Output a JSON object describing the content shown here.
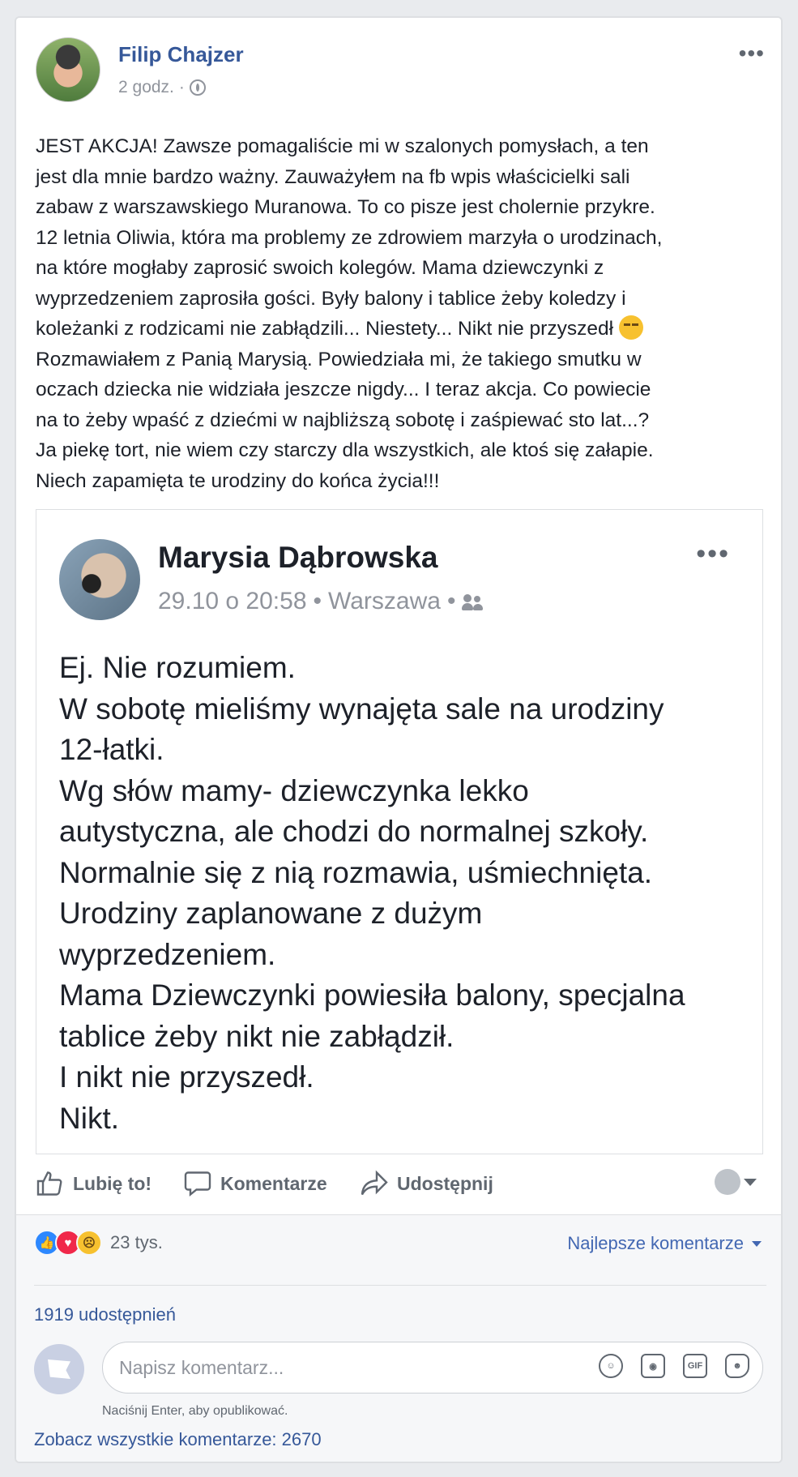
{
  "post": {
    "author": "Filip Chajzer",
    "time": "2 godz.",
    "separator": "·",
    "more": "•••",
    "text_lines": [
      "JEST AKCJA! Zawsze pomagaliście mi w szalonych pomysłach, a ten",
      "jest dla mnie bardzo ważny. Zauważyłem na fb wpis właścicielki sali",
      "zabaw z warszawskiego Muranowa. To co pisze jest cholernie przykre.",
      "12 letnia Oliwia, która ma problemy ze zdrowiem marzyła o urodzinach,",
      "na które mogłaby zaprosić swoich kolegów. Mama dziewczynki z",
      "wyprzedzeniem zaprosiła gości. Były balony i tablice żeby koledzy i",
      "koleżanki z rodzicami nie zabłądzili... Niestety... Nikt nie przyszedł",
      "Rozmawiałem z Panią Marysią. Powiedziała mi, że takiego smutku w",
      "oczach dziecka nie widziała jeszcze nigdy... I teraz akcja. Co powiecie",
      "na to żeby wpaść z dziećmi w najbliższą sobotę i zaśpiewać sto lat...?",
      "Ja piekę tort, nie wiem czy starczy dla wszystkich, ale ktoś się załapie.",
      "Niech zapamięta te urodziny do końca życia!!!"
    ]
  },
  "shared": {
    "author": "Marysia Dąbrowska",
    "date": "29.10 o 20:58",
    "location": "Warszawa",
    "dot": "•",
    "more": "•••",
    "text_lines": [
      "Ej. Nie rozumiem.",
      "W sobotę mieliśmy wynajęta sale na urodziny",
      "12-łatki.",
      "Wg słów mamy- dziewczynka lekko",
      "autystyczna, ale chodzi do normalnej szkoły.",
      "Normalnie się z nią rozmawia, uśmiechnięta.",
      "Urodziny zaplanowane z dużym",
      "wyprzedzeniem.",
      "Mama Dziewczynki powiesiła balony, specjalna",
      "tablice żeby nikt nie zabłądził.",
      "I nikt nie przyszedł.",
      "Nikt."
    ]
  },
  "actions": {
    "like": "Lubię to!",
    "comment": "Komentarze",
    "share": "Udostępnij"
  },
  "footer": {
    "reaction_count": "23 tys.",
    "top_comments": "Najlepsze komentarze",
    "shares": "1919 udostępnień",
    "comment_placeholder": "Napisz komentarz...",
    "gif_label": "GIF",
    "hint": "Naciśnij Enter, aby opublikować.",
    "see_all": "Zobacz wszystkie komentarze: 2670"
  },
  "colors": {
    "link": "#365899",
    "accent": "#4267b2",
    "muted": "#90949c"
  },
  "icons": [
    "globe-icon",
    "friends-icon",
    "like-icon",
    "comment-icon",
    "share-icon",
    "emoji-icon",
    "camera-icon",
    "gif-icon",
    "sticker-icon"
  ]
}
